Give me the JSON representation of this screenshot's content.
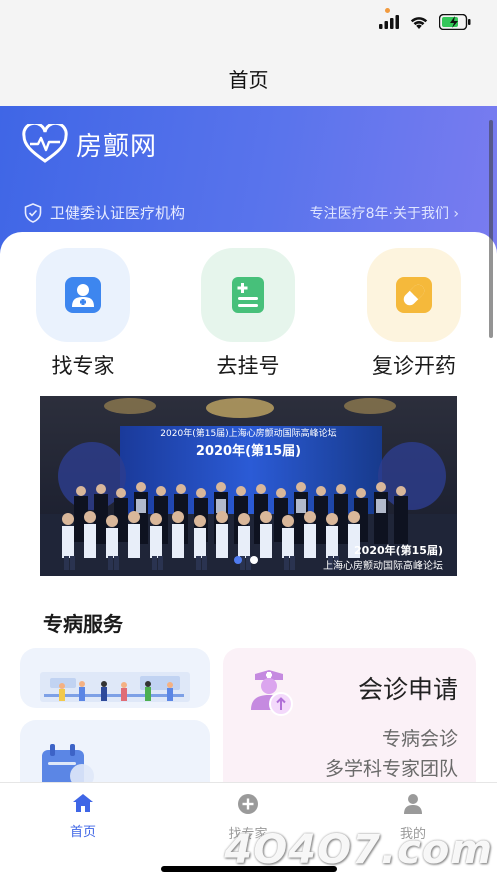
{
  "status_bar": {
    "icons": [
      "signal-icon",
      "wifi-icon",
      "battery-charging-icon"
    ]
  },
  "nav": {
    "title": "首页"
  },
  "hero": {
    "brand_name": "房颤网",
    "certification": "卫健委认证医疗机构",
    "about_link": "专注医疗8年·关于我们 ›"
  },
  "quick_actions": [
    {
      "label": "找专家",
      "icon": "doctor-icon",
      "color": "#3d86ef",
      "bg": "#eaf2fd"
    },
    {
      "label": "去挂号",
      "icon": "register-icon",
      "color": "#47c07a",
      "bg": "#e6f5ec"
    },
    {
      "label": "复诊开药",
      "icon": "pill-icon",
      "color": "#f5b93b",
      "bg": "#fdf4de"
    }
  ],
  "banner": {
    "heading": "2020年(第15届)上海心房颤动国际高峰论坛",
    "stage_text": "2020年(第15届)",
    "corner_line1": "2020年(第15届)",
    "corner_line2": "上海心房颤动国际高峰论坛",
    "active_dot": 0,
    "dot_count": 2
  },
  "services": {
    "title": "专病服务",
    "consult": {
      "title": "会诊申请",
      "sub1": "专病会诊",
      "sub2": "多学科专家团队"
    }
  },
  "tabs": [
    {
      "label": "首页",
      "icon": "home-icon",
      "active": true
    },
    {
      "label": "找专家",
      "icon": "plus-circle-icon",
      "active": false
    },
    {
      "label": "我的",
      "icon": "user-icon",
      "active": false
    }
  ],
  "colors": {
    "accent": "#3f66e6",
    "tab_active": "#3f66e6",
    "tab_inactive": "#999999"
  },
  "watermark": "4O4O7.com"
}
